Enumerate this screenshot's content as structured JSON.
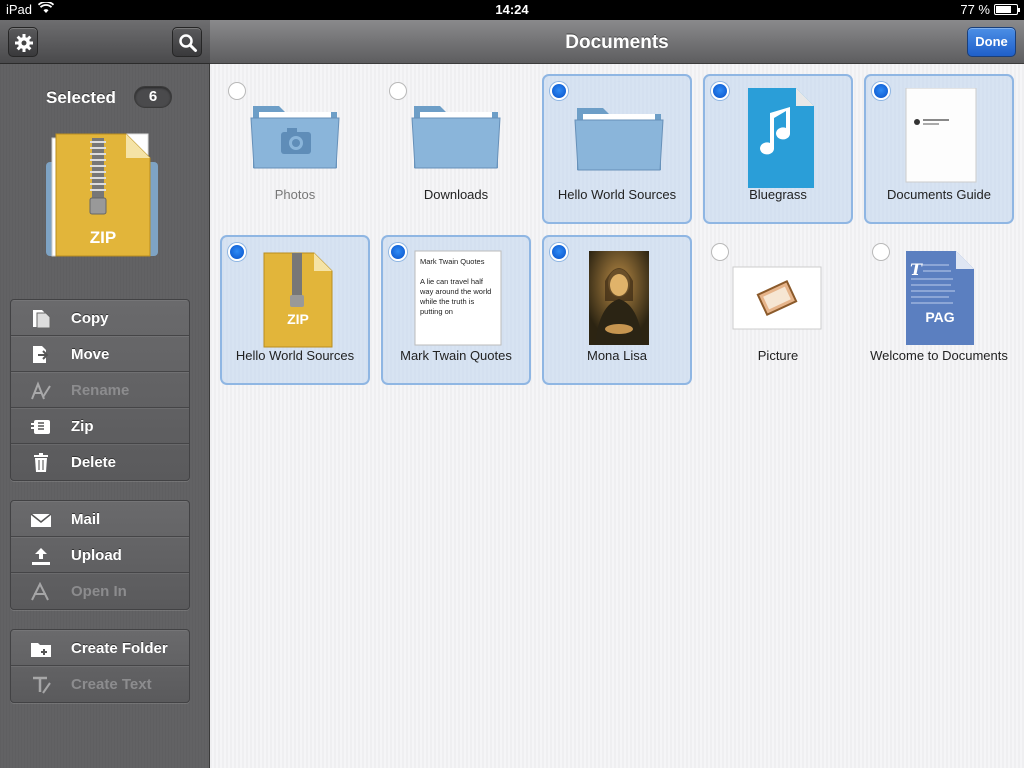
{
  "statusbar": {
    "device": "iPad",
    "time": "14:24",
    "battery": "77 %",
    "battery_level": 0.77
  },
  "sidebar": {
    "selected_label": "Selected",
    "selected_count": "6",
    "preview_label": "ZIP",
    "groups": [
      [
        {
          "label": "Copy",
          "icon": "copy-icon",
          "enabled": true
        },
        {
          "label": "Move",
          "icon": "move-icon",
          "enabled": true
        },
        {
          "label": "Rename",
          "icon": "rename-icon",
          "enabled": false
        },
        {
          "label": "Zip",
          "icon": "zip-icon",
          "enabled": true
        },
        {
          "label": "Delete",
          "icon": "trash-icon",
          "enabled": true
        }
      ],
      [
        {
          "label": "Mail",
          "icon": "mail-icon",
          "enabled": true
        },
        {
          "label": "Upload",
          "icon": "upload-icon",
          "enabled": true
        },
        {
          "label": "Open In",
          "icon": "open-in-icon",
          "enabled": false
        }
      ],
      [
        {
          "label": "Create Folder",
          "icon": "create-folder-icon",
          "enabled": true
        },
        {
          "label": "Create Text",
          "icon": "create-text-icon",
          "enabled": false
        }
      ]
    ]
  },
  "main": {
    "title": "Documents",
    "done_label": "Done",
    "accent": "#1f5fc9",
    "items": [
      {
        "name": "Photos",
        "kind": "folder-camera",
        "selected": false
      },
      {
        "name": "Downloads",
        "kind": "folder",
        "selected": false
      },
      {
        "name": "Hello World Sources",
        "kind": "folder",
        "selected": true
      },
      {
        "name": "Bluegrass",
        "kind": "audio",
        "selected": true
      },
      {
        "name": "Documents Guide",
        "kind": "pdf",
        "selected": true
      },
      {
        "name": "Hello World Sources",
        "kind": "zip",
        "selected": true,
        "badge": "ZIP"
      },
      {
        "name": "Mark Twain Quotes",
        "kind": "text",
        "selected": true,
        "preview_title": "Mark Twain Quotes",
        "preview_body": "A lie can travel half way around the world while the truth is putting on"
      },
      {
        "name": "Mona Lisa",
        "kind": "image",
        "selected": true
      },
      {
        "name": "Picture",
        "kind": "picture",
        "selected": false
      },
      {
        "name": "Welcome to Documents",
        "kind": "pages",
        "selected": false,
        "badge": "PAG"
      }
    ]
  }
}
